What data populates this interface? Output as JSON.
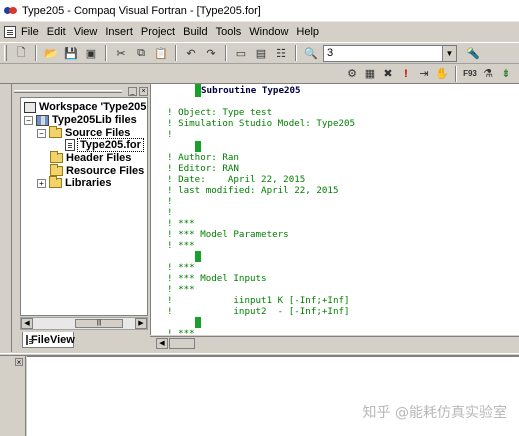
{
  "window": {
    "title": "Type205 - Compaq Visual Fortran - [Type205.for]"
  },
  "menu": [
    "File",
    "Edit",
    "View",
    "Insert",
    "Project",
    "Build",
    "Tools",
    "Window",
    "Help"
  ],
  "toolbar": {
    "combo_value": "3"
  },
  "workspace": {
    "tree": {
      "workspace_label": "Workspace 'Type205':",
      "project_label": "Type205Lib files",
      "source_files_label": "Source Files",
      "file_label": "Type205.for",
      "header_files_label": "Header Files",
      "resource_files_label": "Resource Files",
      "libraries_label": "Libraries"
    },
    "tab_label": "FileView"
  },
  "editor": {
    "lines": [
      "Subroutine Type205",
      "! Object: Type test",
      "! Simulation Studio Model: Type205",
      "!",
      "! Author: Ran",
      "! Editor: RAN",
      "! Date:    April 22, 2015",
      "! last modified: April 22, 2015",
      "!",
      "!",
      "! ***",
      "! *** Model Parameters",
      "! ***",
      "! ***",
      "! *** Model Inputs",
      "! ***",
      "!           iinput1 K [-Inf;+Inf]",
      "!           input2  - [-Inf;+Inf]",
      "! ***"
    ]
  },
  "watermark": "知乎 @能耗仿真实验室"
}
